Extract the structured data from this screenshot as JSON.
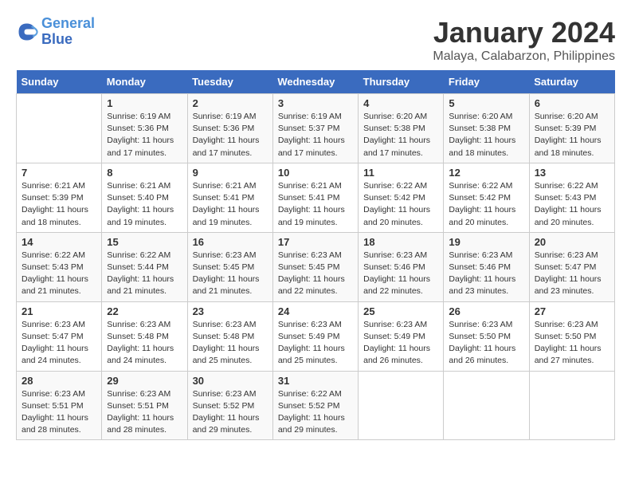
{
  "logo": {
    "line1": "General",
    "line2": "Blue"
  },
  "title": "January 2024",
  "subtitle": "Malaya, Calabarzon, Philippines",
  "headers": [
    "Sunday",
    "Monday",
    "Tuesday",
    "Wednesday",
    "Thursday",
    "Friday",
    "Saturday"
  ],
  "weeks": [
    [
      {
        "day": "",
        "sunrise": "",
        "sunset": "",
        "daylight": ""
      },
      {
        "day": "1",
        "sunrise": "Sunrise: 6:19 AM",
        "sunset": "Sunset: 5:36 PM",
        "daylight": "Daylight: 11 hours and 17 minutes."
      },
      {
        "day": "2",
        "sunrise": "Sunrise: 6:19 AM",
        "sunset": "Sunset: 5:36 PM",
        "daylight": "Daylight: 11 hours and 17 minutes."
      },
      {
        "day": "3",
        "sunrise": "Sunrise: 6:19 AM",
        "sunset": "Sunset: 5:37 PM",
        "daylight": "Daylight: 11 hours and 17 minutes."
      },
      {
        "day": "4",
        "sunrise": "Sunrise: 6:20 AM",
        "sunset": "Sunset: 5:38 PM",
        "daylight": "Daylight: 11 hours and 17 minutes."
      },
      {
        "day": "5",
        "sunrise": "Sunrise: 6:20 AM",
        "sunset": "Sunset: 5:38 PM",
        "daylight": "Daylight: 11 hours and 18 minutes."
      },
      {
        "day": "6",
        "sunrise": "Sunrise: 6:20 AM",
        "sunset": "Sunset: 5:39 PM",
        "daylight": "Daylight: 11 hours and 18 minutes."
      }
    ],
    [
      {
        "day": "7",
        "sunrise": "Sunrise: 6:21 AM",
        "sunset": "Sunset: 5:39 PM",
        "daylight": "Daylight: 11 hours and 18 minutes."
      },
      {
        "day": "8",
        "sunrise": "Sunrise: 6:21 AM",
        "sunset": "Sunset: 5:40 PM",
        "daylight": "Daylight: 11 hours and 19 minutes."
      },
      {
        "day": "9",
        "sunrise": "Sunrise: 6:21 AM",
        "sunset": "Sunset: 5:41 PM",
        "daylight": "Daylight: 11 hours and 19 minutes."
      },
      {
        "day": "10",
        "sunrise": "Sunrise: 6:21 AM",
        "sunset": "Sunset: 5:41 PM",
        "daylight": "Daylight: 11 hours and 19 minutes."
      },
      {
        "day": "11",
        "sunrise": "Sunrise: 6:22 AM",
        "sunset": "Sunset: 5:42 PM",
        "daylight": "Daylight: 11 hours and 20 minutes."
      },
      {
        "day": "12",
        "sunrise": "Sunrise: 6:22 AM",
        "sunset": "Sunset: 5:42 PM",
        "daylight": "Daylight: 11 hours and 20 minutes."
      },
      {
        "day": "13",
        "sunrise": "Sunrise: 6:22 AM",
        "sunset": "Sunset: 5:43 PM",
        "daylight": "Daylight: 11 hours and 20 minutes."
      }
    ],
    [
      {
        "day": "14",
        "sunrise": "Sunrise: 6:22 AM",
        "sunset": "Sunset: 5:43 PM",
        "daylight": "Daylight: 11 hours and 21 minutes."
      },
      {
        "day": "15",
        "sunrise": "Sunrise: 6:22 AM",
        "sunset": "Sunset: 5:44 PM",
        "daylight": "Daylight: 11 hours and 21 minutes."
      },
      {
        "day": "16",
        "sunrise": "Sunrise: 6:23 AM",
        "sunset": "Sunset: 5:45 PM",
        "daylight": "Daylight: 11 hours and 21 minutes."
      },
      {
        "day": "17",
        "sunrise": "Sunrise: 6:23 AM",
        "sunset": "Sunset: 5:45 PM",
        "daylight": "Daylight: 11 hours and 22 minutes."
      },
      {
        "day": "18",
        "sunrise": "Sunrise: 6:23 AM",
        "sunset": "Sunset: 5:46 PM",
        "daylight": "Daylight: 11 hours and 22 minutes."
      },
      {
        "day": "19",
        "sunrise": "Sunrise: 6:23 AM",
        "sunset": "Sunset: 5:46 PM",
        "daylight": "Daylight: 11 hours and 23 minutes."
      },
      {
        "day": "20",
        "sunrise": "Sunrise: 6:23 AM",
        "sunset": "Sunset: 5:47 PM",
        "daylight": "Daylight: 11 hours and 23 minutes."
      }
    ],
    [
      {
        "day": "21",
        "sunrise": "Sunrise: 6:23 AM",
        "sunset": "Sunset: 5:47 PM",
        "daylight": "Daylight: 11 hours and 24 minutes."
      },
      {
        "day": "22",
        "sunrise": "Sunrise: 6:23 AM",
        "sunset": "Sunset: 5:48 PM",
        "daylight": "Daylight: 11 hours and 24 minutes."
      },
      {
        "day": "23",
        "sunrise": "Sunrise: 6:23 AM",
        "sunset": "Sunset: 5:48 PM",
        "daylight": "Daylight: 11 hours and 25 minutes."
      },
      {
        "day": "24",
        "sunrise": "Sunrise: 6:23 AM",
        "sunset": "Sunset: 5:49 PM",
        "daylight": "Daylight: 11 hours and 25 minutes."
      },
      {
        "day": "25",
        "sunrise": "Sunrise: 6:23 AM",
        "sunset": "Sunset: 5:49 PM",
        "daylight": "Daylight: 11 hours and 26 minutes."
      },
      {
        "day": "26",
        "sunrise": "Sunrise: 6:23 AM",
        "sunset": "Sunset: 5:50 PM",
        "daylight": "Daylight: 11 hours and 26 minutes."
      },
      {
        "day": "27",
        "sunrise": "Sunrise: 6:23 AM",
        "sunset": "Sunset: 5:50 PM",
        "daylight": "Daylight: 11 hours and 27 minutes."
      }
    ],
    [
      {
        "day": "28",
        "sunrise": "Sunrise: 6:23 AM",
        "sunset": "Sunset: 5:51 PM",
        "daylight": "Daylight: 11 hours and 28 minutes."
      },
      {
        "day": "29",
        "sunrise": "Sunrise: 6:23 AM",
        "sunset": "Sunset: 5:51 PM",
        "daylight": "Daylight: 11 hours and 28 minutes."
      },
      {
        "day": "30",
        "sunrise": "Sunrise: 6:23 AM",
        "sunset": "Sunset: 5:52 PM",
        "daylight": "Daylight: 11 hours and 29 minutes."
      },
      {
        "day": "31",
        "sunrise": "Sunrise: 6:22 AM",
        "sunset": "Sunset: 5:52 PM",
        "daylight": "Daylight: 11 hours and 29 minutes."
      },
      {
        "day": "",
        "sunrise": "",
        "sunset": "",
        "daylight": ""
      },
      {
        "day": "",
        "sunrise": "",
        "sunset": "",
        "daylight": ""
      },
      {
        "day": "",
        "sunrise": "",
        "sunset": "",
        "daylight": ""
      }
    ]
  ]
}
